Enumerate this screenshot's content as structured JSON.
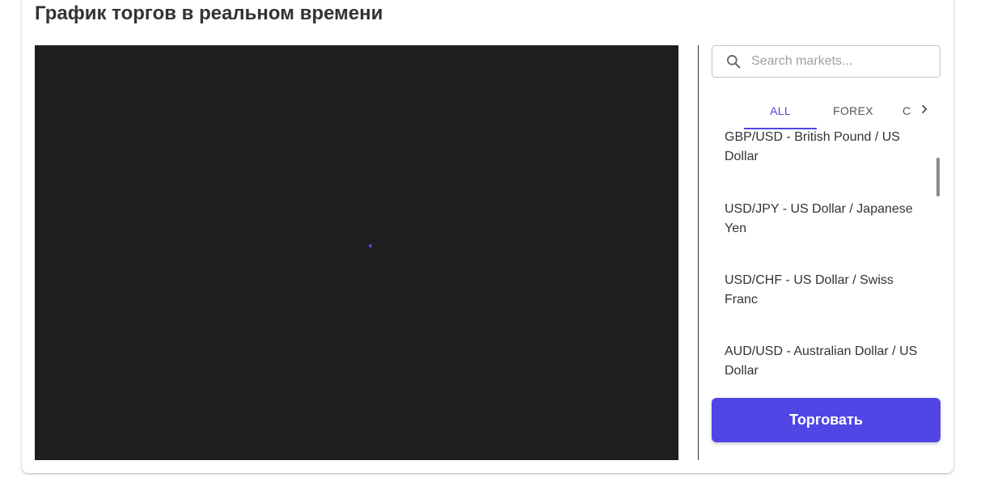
{
  "page": {
    "title": "График торгов в реальном времени"
  },
  "search": {
    "placeholder": "Search markets..."
  },
  "tabs": [
    {
      "label": "ALL",
      "selected": true
    },
    {
      "label": "FOREX",
      "selected": false
    },
    {
      "label": "C",
      "selected": false
    }
  ],
  "markets": [
    {
      "line1": "GBP/USD - British Pound / US",
      "line2": "Dollar"
    },
    {
      "line1": "USD/JPY - US Dollar / Japanese",
      "line2": "Yen"
    },
    {
      "line1": "USD/CHF - US Dollar / Swiss",
      "line2": "Franc"
    },
    {
      "line1": "AUD/USD - Australian Dollar / US",
      "line2": "Dollar"
    }
  ],
  "trade_button": {
    "label": "Торговать"
  },
  "icons": {
    "search": "search-icon",
    "tabs_scroll": "chevron-right-icon"
  },
  "colors": {
    "accent": "#4f46e5",
    "chart_background": "#1e1e1e"
  }
}
